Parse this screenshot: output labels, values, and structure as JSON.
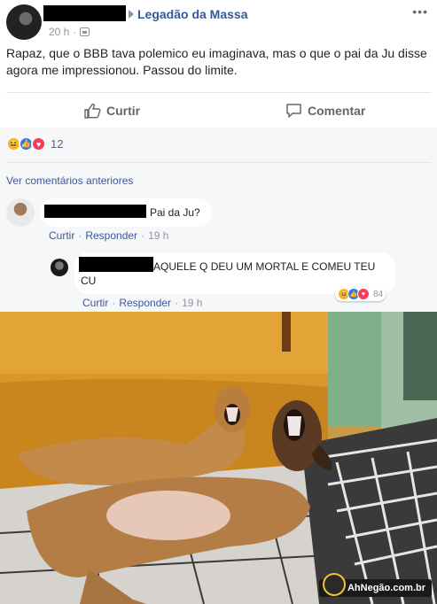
{
  "post": {
    "page_name": "Legadão da Massa",
    "time": "20 h",
    "more": "•••",
    "text": "Rapaz, que o BBB tava polemico eu imaginava, mas o que o pai da Ju disse agora me impressionou. Passou do limite."
  },
  "actions": {
    "like_label": "Curtir",
    "comment_label": "Comentar"
  },
  "reactions": {
    "icons": [
      "haha-icon",
      "like-icon",
      "love-icon"
    ],
    "count": "12"
  },
  "comments": {
    "view_previous": "Ver comentários anteriores",
    "items": [
      {
        "text": "Pai da Ju?",
        "like": "Curtir",
        "reply": "Responder",
        "time": "19 h"
      },
      {
        "text": "AQUELE Q DEU UM MORTAL E COMEU TEU CU",
        "like": "Curtir",
        "reply": "Responder",
        "time": "19 h",
        "reaction_count": "84"
      }
    ]
  },
  "watermark": "AhNegão.com.br",
  "colors": {
    "brand_link": "#365899",
    "haha": "#f7b125",
    "like": "#3578e5",
    "love": "#f33e58"
  }
}
